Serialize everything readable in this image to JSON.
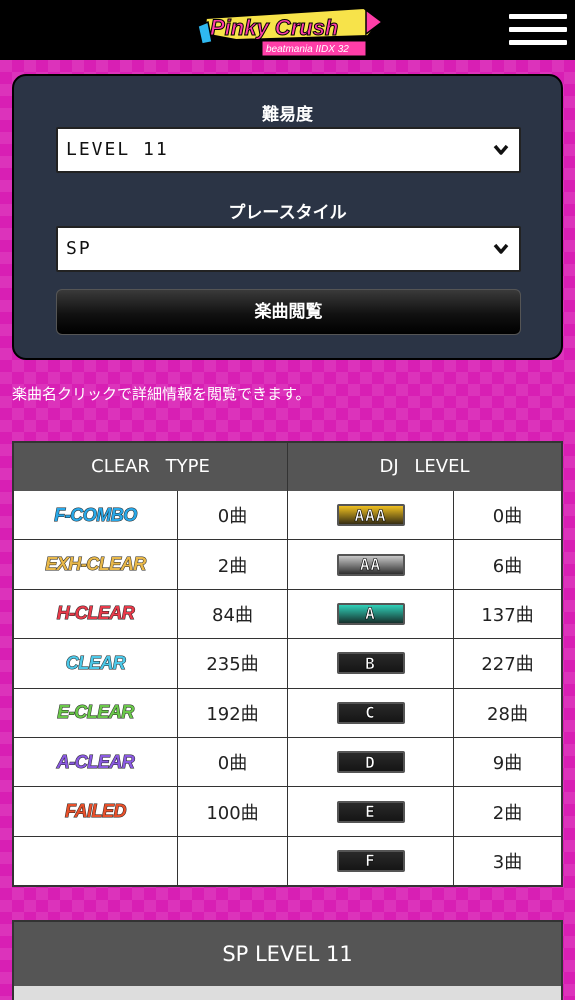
{
  "header": {
    "logo_title": "Pinky Crush",
    "logo_subtitle": "beatmania IIDX 32",
    "menu_icon": "hamburger-icon"
  },
  "filter": {
    "difficulty_label": "難易度",
    "difficulty_value": "LEVEL 11",
    "style_label": "プレースタイル",
    "style_value": "SP",
    "browse_button": "楽曲閲覧"
  },
  "hint": "楽曲名クリックで詳細情報を閲覧できます。",
  "stats": {
    "clear_header": "CLEAR TYPE",
    "dj_header": "DJ LEVEL",
    "clear_rows": [
      {
        "label": "F-COMBO",
        "count": "0曲",
        "color": "#29a8e8"
      },
      {
        "label": "EXH-CLEAR",
        "count": "2曲",
        "color": "#e8b84a"
      },
      {
        "label": "H-CLEAR",
        "count": "84曲",
        "color": "#e83a4a"
      },
      {
        "label": "CLEAR",
        "count": "235曲",
        "color": "#4cc8e8"
      },
      {
        "label": "E-CLEAR",
        "count": "192曲",
        "color": "#6ac84a"
      },
      {
        "label": "A-CLEAR",
        "count": "0曲",
        "color": "#8a5ae0"
      },
      {
        "label": "FAILED",
        "count": "100曲",
        "color": "#e8502a"
      }
    ],
    "dj_rows": [
      {
        "label": "AAA",
        "count": "0曲",
        "bg": "#f0c020"
      },
      {
        "label": "AA",
        "count": "6曲",
        "bg": "#c8c8c8"
      },
      {
        "label": "A",
        "count": "137曲",
        "bg": "#30d0b8"
      },
      {
        "label": "B",
        "count": "227曲",
        "bg": "#2a2a2a"
      },
      {
        "label": "C",
        "count": "28曲",
        "bg": "#2a2a2a"
      },
      {
        "label": "D",
        "count": "9曲",
        "bg": "#2a2a2a"
      },
      {
        "label": "E",
        "count": "2曲",
        "bg": "#2a2a2a"
      },
      {
        "label": "F",
        "count": "3曲",
        "bg": "#2a2a2a"
      }
    ]
  },
  "section": {
    "title": "SP LEVEL 11"
  }
}
